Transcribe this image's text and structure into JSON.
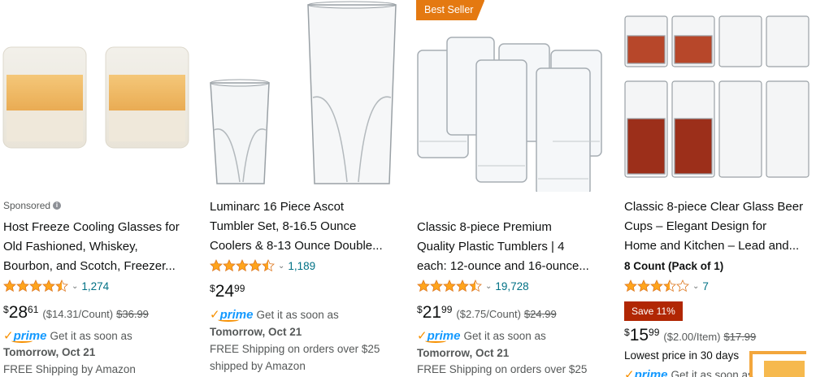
{
  "products": [
    {
      "sponsored_label": "Sponsored",
      "title_lines": [
        "Host Freeze Cooling Glasses for",
        "Old Fashioned, Whiskey,",
        "Bourbon, and Scotch, Freezer..."
      ],
      "rating": 4.5,
      "review_count": "1,274",
      "price": {
        "symbol": "$",
        "whole": "28",
        "fraction": "61",
        "unit": "($14.31/Count)",
        "list": "$36.99"
      },
      "prime_label": "prime",
      "delivery_prefix": "Get it as soon as",
      "delivery_date": "Tomorrow, Oct 21",
      "shipping": "FREE Shipping by Amazon"
    },
    {
      "title_lines": [
        "Luminarc 16 Piece Ascot",
        "Tumbler Set, 8-16.5 Ounce",
        "Coolers & 8-13 Ounce Double..."
      ],
      "rating": 4.5,
      "review_count": "1,189",
      "price": {
        "symbol": "$",
        "whole": "24",
        "fraction": "99"
      },
      "prime_label": "prime",
      "delivery_prefix": "Get it as soon as",
      "delivery_date": "Tomorrow, Oct 21",
      "shipping_lines": [
        "FREE Shipping on orders over $25",
        "shipped by Amazon"
      ]
    },
    {
      "badge": "Best Seller",
      "title_lines": [
        "Classic 8-piece Premium",
        "Quality Plastic Tumblers | 4",
        "each: 12-ounce and 16-ounce..."
      ],
      "rating": 4.5,
      "review_count": "19,728",
      "price": {
        "symbol": "$",
        "whole": "21",
        "fraction": "99",
        "unit": "($2.75/Count)",
        "list": "$24.99"
      },
      "prime_label": "prime",
      "delivery_prefix": "Get it as soon as",
      "delivery_date": "Tomorrow, Oct 21",
      "shipping": "FREE Shipping on orders over $25"
    },
    {
      "title_lines": [
        "Classic 8-piece Clear Glass Beer",
        "Cups – Elegant Design for",
        "Home and Kitchen – Lead and..."
      ],
      "count_line": "8 Count (Pack of 1)",
      "rating": 3.5,
      "review_count": "7",
      "save_badge": "Save 11%",
      "price": {
        "symbol": "$",
        "whole": "15",
        "fraction": "99",
        "unit": "($2.00/Item)",
        "list": "$17.99"
      },
      "lowest_price": "Lowest price in 30 days",
      "prime_label": "prime",
      "delivery_prefix": "Get it as soon as"
    }
  ],
  "colors": {
    "star": "#ffa41c",
    "link": "#007185",
    "prime_blue": "#1399ff",
    "prime_orange": "#f79000",
    "best_seller": "#e47911",
    "deal_red": "#b12704"
  },
  "icons": [
    "info-icon",
    "star-icon",
    "chevron-down-icon",
    "prime-check-icon"
  ]
}
